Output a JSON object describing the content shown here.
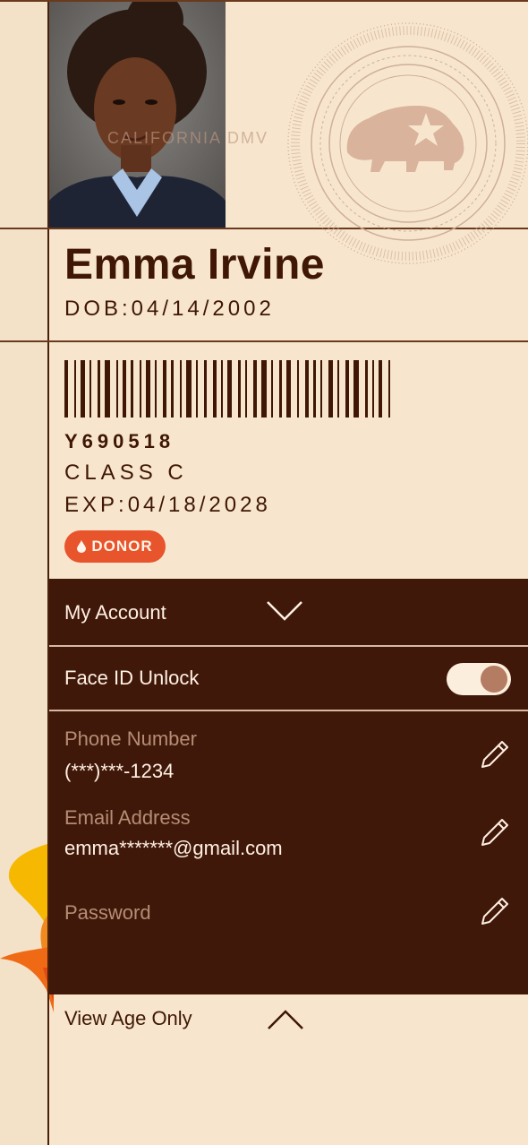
{
  "license": {
    "watermark": "CALIFORNIA DMV",
    "name": "Emma Irvine",
    "dob": "DOB:04/14/2002",
    "id_number": "Y690518",
    "class": "CLASS C",
    "exp": "EXP:04/18/2028",
    "donor_badge": "DONOR"
  },
  "account": {
    "title": "My Account",
    "face_id_label": "Face ID Unlock",
    "face_id_enabled": true,
    "fields": [
      {
        "label": "Phone Number",
        "value": "(***)***-1234"
      },
      {
        "label": "Email Address",
        "value": "emma*******@gmail.com"
      },
      {
        "label": "Password",
        "value": ""
      }
    ]
  },
  "view_age": {
    "label": "View Age Only"
  },
  "icons": {
    "account_toggle": "chevron-down-icon",
    "view_age_toggle": "chevron-up-icon",
    "edit": "pencil-icon",
    "donor": "drop-icon",
    "seal": "bear-star-seal-icon"
  },
  "colors": {
    "background": "#f7e6cd",
    "dark_panel": "#40180a",
    "text_dark": "#3f1704",
    "donor": "#e8542b",
    "toggle_knob": "#b47c62"
  }
}
